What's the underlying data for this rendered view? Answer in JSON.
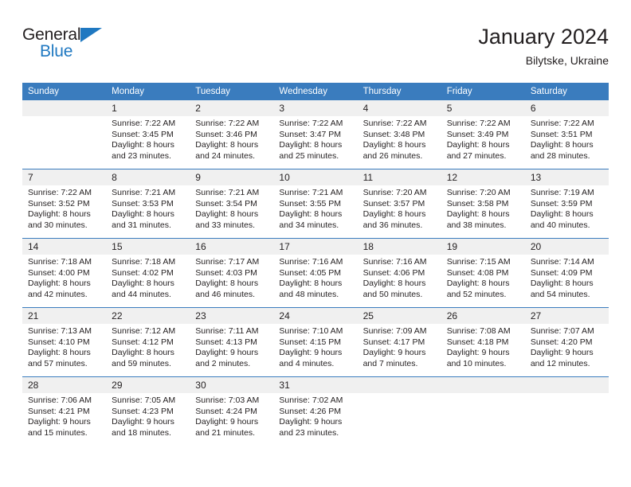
{
  "brand": {
    "name_part1": "General",
    "name_part2": "Blue",
    "accent_color": "#1f78c1"
  },
  "header": {
    "title": "January 2024",
    "subtitle": "Bilytske, Ukraine"
  },
  "theme": {
    "header_row_bg": "#3a7cbe",
    "daynum_bg": "#f0f0f0",
    "text_color": "#231f20"
  },
  "weekday_headers": [
    "Sunday",
    "Monday",
    "Tuesday",
    "Wednesday",
    "Thursday",
    "Friday",
    "Saturday"
  ],
  "weeks": [
    [
      {
        "day": "",
        "lines": []
      },
      {
        "day": "1",
        "lines": [
          "Sunrise: 7:22 AM",
          "Sunset: 3:45 PM",
          "Daylight: 8 hours",
          "and 23 minutes."
        ]
      },
      {
        "day": "2",
        "lines": [
          "Sunrise: 7:22 AM",
          "Sunset: 3:46 PM",
          "Daylight: 8 hours",
          "and 24 minutes."
        ]
      },
      {
        "day": "3",
        "lines": [
          "Sunrise: 7:22 AM",
          "Sunset: 3:47 PM",
          "Daylight: 8 hours",
          "and 25 minutes."
        ]
      },
      {
        "day": "4",
        "lines": [
          "Sunrise: 7:22 AM",
          "Sunset: 3:48 PM",
          "Daylight: 8 hours",
          "and 26 minutes."
        ]
      },
      {
        "day": "5",
        "lines": [
          "Sunrise: 7:22 AM",
          "Sunset: 3:49 PM",
          "Daylight: 8 hours",
          "and 27 minutes."
        ]
      },
      {
        "day": "6",
        "lines": [
          "Sunrise: 7:22 AM",
          "Sunset: 3:51 PM",
          "Daylight: 8 hours",
          "and 28 minutes."
        ]
      }
    ],
    [
      {
        "day": "7",
        "lines": [
          "Sunrise: 7:22 AM",
          "Sunset: 3:52 PM",
          "Daylight: 8 hours",
          "and 30 minutes."
        ]
      },
      {
        "day": "8",
        "lines": [
          "Sunrise: 7:21 AM",
          "Sunset: 3:53 PM",
          "Daylight: 8 hours",
          "and 31 minutes."
        ]
      },
      {
        "day": "9",
        "lines": [
          "Sunrise: 7:21 AM",
          "Sunset: 3:54 PM",
          "Daylight: 8 hours",
          "and 33 minutes."
        ]
      },
      {
        "day": "10",
        "lines": [
          "Sunrise: 7:21 AM",
          "Sunset: 3:55 PM",
          "Daylight: 8 hours",
          "and 34 minutes."
        ]
      },
      {
        "day": "11",
        "lines": [
          "Sunrise: 7:20 AM",
          "Sunset: 3:57 PM",
          "Daylight: 8 hours",
          "and 36 minutes."
        ]
      },
      {
        "day": "12",
        "lines": [
          "Sunrise: 7:20 AM",
          "Sunset: 3:58 PM",
          "Daylight: 8 hours",
          "and 38 minutes."
        ]
      },
      {
        "day": "13",
        "lines": [
          "Sunrise: 7:19 AM",
          "Sunset: 3:59 PM",
          "Daylight: 8 hours",
          "and 40 minutes."
        ]
      }
    ],
    [
      {
        "day": "14",
        "lines": [
          "Sunrise: 7:18 AM",
          "Sunset: 4:00 PM",
          "Daylight: 8 hours",
          "and 42 minutes."
        ]
      },
      {
        "day": "15",
        "lines": [
          "Sunrise: 7:18 AM",
          "Sunset: 4:02 PM",
          "Daylight: 8 hours",
          "and 44 minutes."
        ]
      },
      {
        "day": "16",
        "lines": [
          "Sunrise: 7:17 AM",
          "Sunset: 4:03 PM",
          "Daylight: 8 hours",
          "and 46 minutes."
        ]
      },
      {
        "day": "17",
        "lines": [
          "Sunrise: 7:16 AM",
          "Sunset: 4:05 PM",
          "Daylight: 8 hours",
          "and 48 minutes."
        ]
      },
      {
        "day": "18",
        "lines": [
          "Sunrise: 7:16 AM",
          "Sunset: 4:06 PM",
          "Daylight: 8 hours",
          "and 50 minutes."
        ]
      },
      {
        "day": "19",
        "lines": [
          "Sunrise: 7:15 AM",
          "Sunset: 4:08 PM",
          "Daylight: 8 hours",
          "and 52 minutes."
        ]
      },
      {
        "day": "20",
        "lines": [
          "Sunrise: 7:14 AM",
          "Sunset: 4:09 PM",
          "Daylight: 8 hours",
          "and 54 minutes."
        ]
      }
    ],
    [
      {
        "day": "21",
        "lines": [
          "Sunrise: 7:13 AM",
          "Sunset: 4:10 PM",
          "Daylight: 8 hours",
          "and 57 minutes."
        ]
      },
      {
        "day": "22",
        "lines": [
          "Sunrise: 7:12 AM",
          "Sunset: 4:12 PM",
          "Daylight: 8 hours",
          "and 59 minutes."
        ]
      },
      {
        "day": "23",
        "lines": [
          "Sunrise: 7:11 AM",
          "Sunset: 4:13 PM",
          "Daylight: 9 hours",
          "and 2 minutes."
        ]
      },
      {
        "day": "24",
        "lines": [
          "Sunrise: 7:10 AM",
          "Sunset: 4:15 PM",
          "Daylight: 9 hours",
          "and 4 minutes."
        ]
      },
      {
        "day": "25",
        "lines": [
          "Sunrise: 7:09 AM",
          "Sunset: 4:17 PM",
          "Daylight: 9 hours",
          "and 7 minutes."
        ]
      },
      {
        "day": "26",
        "lines": [
          "Sunrise: 7:08 AM",
          "Sunset: 4:18 PM",
          "Daylight: 9 hours",
          "and 10 minutes."
        ]
      },
      {
        "day": "27",
        "lines": [
          "Sunrise: 7:07 AM",
          "Sunset: 4:20 PM",
          "Daylight: 9 hours",
          "and 12 minutes."
        ]
      }
    ],
    [
      {
        "day": "28",
        "lines": [
          "Sunrise: 7:06 AM",
          "Sunset: 4:21 PM",
          "Daylight: 9 hours",
          "and 15 minutes."
        ]
      },
      {
        "day": "29",
        "lines": [
          "Sunrise: 7:05 AM",
          "Sunset: 4:23 PM",
          "Daylight: 9 hours",
          "and 18 minutes."
        ]
      },
      {
        "day": "30",
        "lines": [
          "Sunrise: 7:03 AM",
          "Sunset: 4:24 PM",
          "Daylight: 9 hours",
          "and 21 minutes."
        ]
      },
      {
        "day": "31",
        "lines": [
          "Sunrise: 7:02 AM",
          "Sunset: 4:26 PM",
          "Daylight: 9 hours",
          "and 23 minutes."
        ]
      },
      {
        "day": "",
        "lines": []
      },
      {
        "day": "",
        "lines": []
      },
      {
        "day": "",
        "lines": []
      }
    ]
  ]
}
